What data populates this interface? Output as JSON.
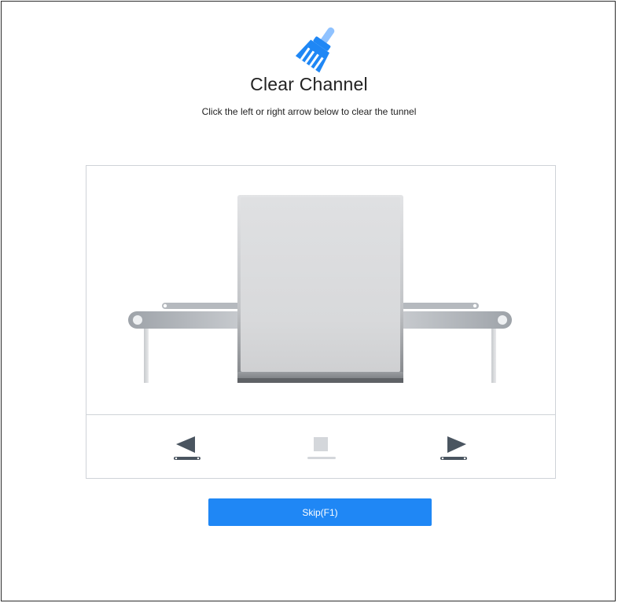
{
  "header": {
    "icon": "broom-brush-icon",
    "title": "Clear Channel",
    "subtitle": "Click the left or right arrow below to clear the tunnel"
  },
  "scene": {
    "description_icon": "xray-scanner-tunnel-illustration"
  },
  "controls": {
    "left": {
      "icon": "arrow-left-icon"
    },
    "stop": {
      "icon": "stop-square-icon"
    },
    "right": {
      "icon": "arrow-right-icon"
    }
  },
  "skip_button": {
    "label": "Skip(F1)"
  },
  "colors": {
    "accent": "#1f87f5",
    "control_active": "#4a5560",
    "control_disabled": "#d4d7db",
    "panel_border": "#cfd3d8"
  }
}
